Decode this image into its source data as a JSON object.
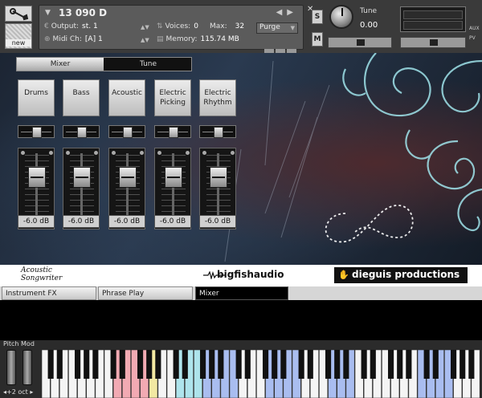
{
  "header": {
    "instrument_name": "13 090 D",
    "output_label": "Output:",
    "output_value": "st. 1",
    "voices_label": "Voices:",
    "voices_value": "0",
    "max_label": "Max:",
    "max_value": "32",
    "purge_label": "Purge",
    "midi_label": "Midi Ch:",
    "midi_value": "[A]  1",
    "memory_label": "Memory:",
    "memory_value": "115.74 MB",
    "new_label": "new",
    "solo_label": "S",
    "mute_label": "M",
    "tune_label": "Tune",
    "tune_value": "0.00",
    "aux_label": "AUX",
    "pv_label": "PV",
    "nav_prev": "◀",
    "nav_next": "▶",
    "close_label": "✕",
    "collapse_arrow": "▼",
    "output_icon": "€",
    "voices_icon": "⇅",
    "midi_icon": "⊕",
    "memory_icon": "▤",
    "pan_icon": "◀▶"
  },
  "tabs": {
    "mixer": "Mixer",
    "tune": "Tune"
  },
  "channels": [
    {
      "name_line1": "Drums",
      "name_line2": "",
      "volume": "-6.0 dB",
      "fader_level": 0.72
    },
    {
      "name_line1": "Bass",
      "name_line2": "",
      "volume": "-6.0 dB",
      "fader_level": 0.72
    },
    {
      "name_line1": "Acoustic",
      "name_line2": "",
      "volume": "-6.0 dB",
      "fader_level": 0.72
    },
    {
      "name_line1": "Electric",
      "name_line2": "Picking",
      "volume": "-6.0 dB",
      "fader_level": 0.72
    },
    {
      "name_line1": "Electric",
      "name_line2": "Rhythm",
      "volume": "-6.0 dB",
      "fader_level": 0.72
    }
  ],
  "branding": {
    "product_line1": "Acoustic",
    "product_line2": "Songwriter",
    "publisher": "bigfishaudio",
    "developer": "dieguis productions"
  },
  "bottom_tabs": {
    "instrument_fx": "Instrument FX",
    "phrase_play": "Phrase Play",
    "mixer": "Mixer"
  },
  "keyboard": {
    "pitch_mod_label": "Pitch Mod",
    "octave_label": "◂+2 oct ▸",
    "zone_colors": {
      "red": "#f2aab3",
      "yellow": "#f3e9a2",
      "cyan": "#aee4ec",
      "blue": "#a9bdf0",
      "white": "#f4f4f4"
    }
  },
  "colors": {
    "header_bg": "#3a3a3a",
    "panel_bg": "#5b5b5b",
    "accent_swirl": "#9fe3ea"
  }
}
